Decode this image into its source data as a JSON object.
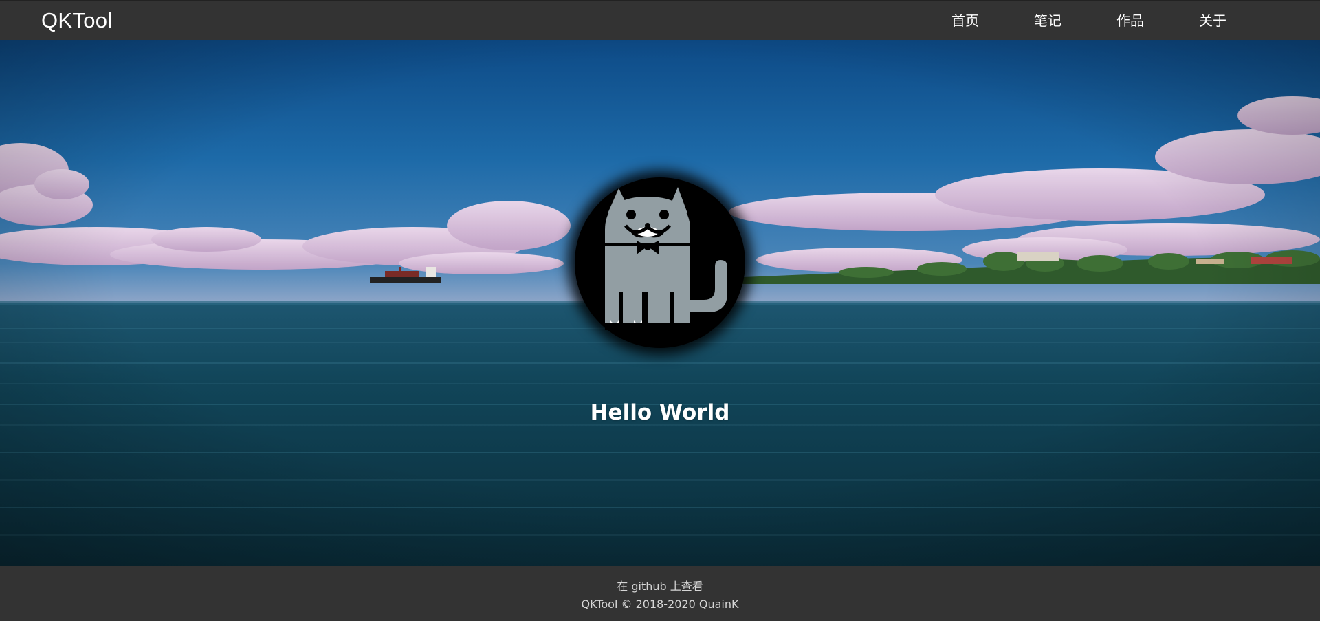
{
  "navbar": {
    "brand": "QKTool",
    "links": [
      {
        "label": "首页"
      },
      {
        "label": "笔记"
      },
      {
        "label": "作品"
      },
      {
        "label": "关于"
      }
    ]
  },
  "hero": {
    "title": "Hello World",
    "avatar_icon": "android-cat-icon",
    "background": "ocean-sky-photo"
  },
  "footer": {
    "github_prefix": "在 ",
    "github_link": "github",
    "github_suffix": " 上查看",
    "copyright": "QKTool © 2018-2020 QuainK"
  },
  "colors": {
    "bar": "#333333",
    "text": "#ffffff",
    "footer_text": "#d6d6d6"
  }
}
